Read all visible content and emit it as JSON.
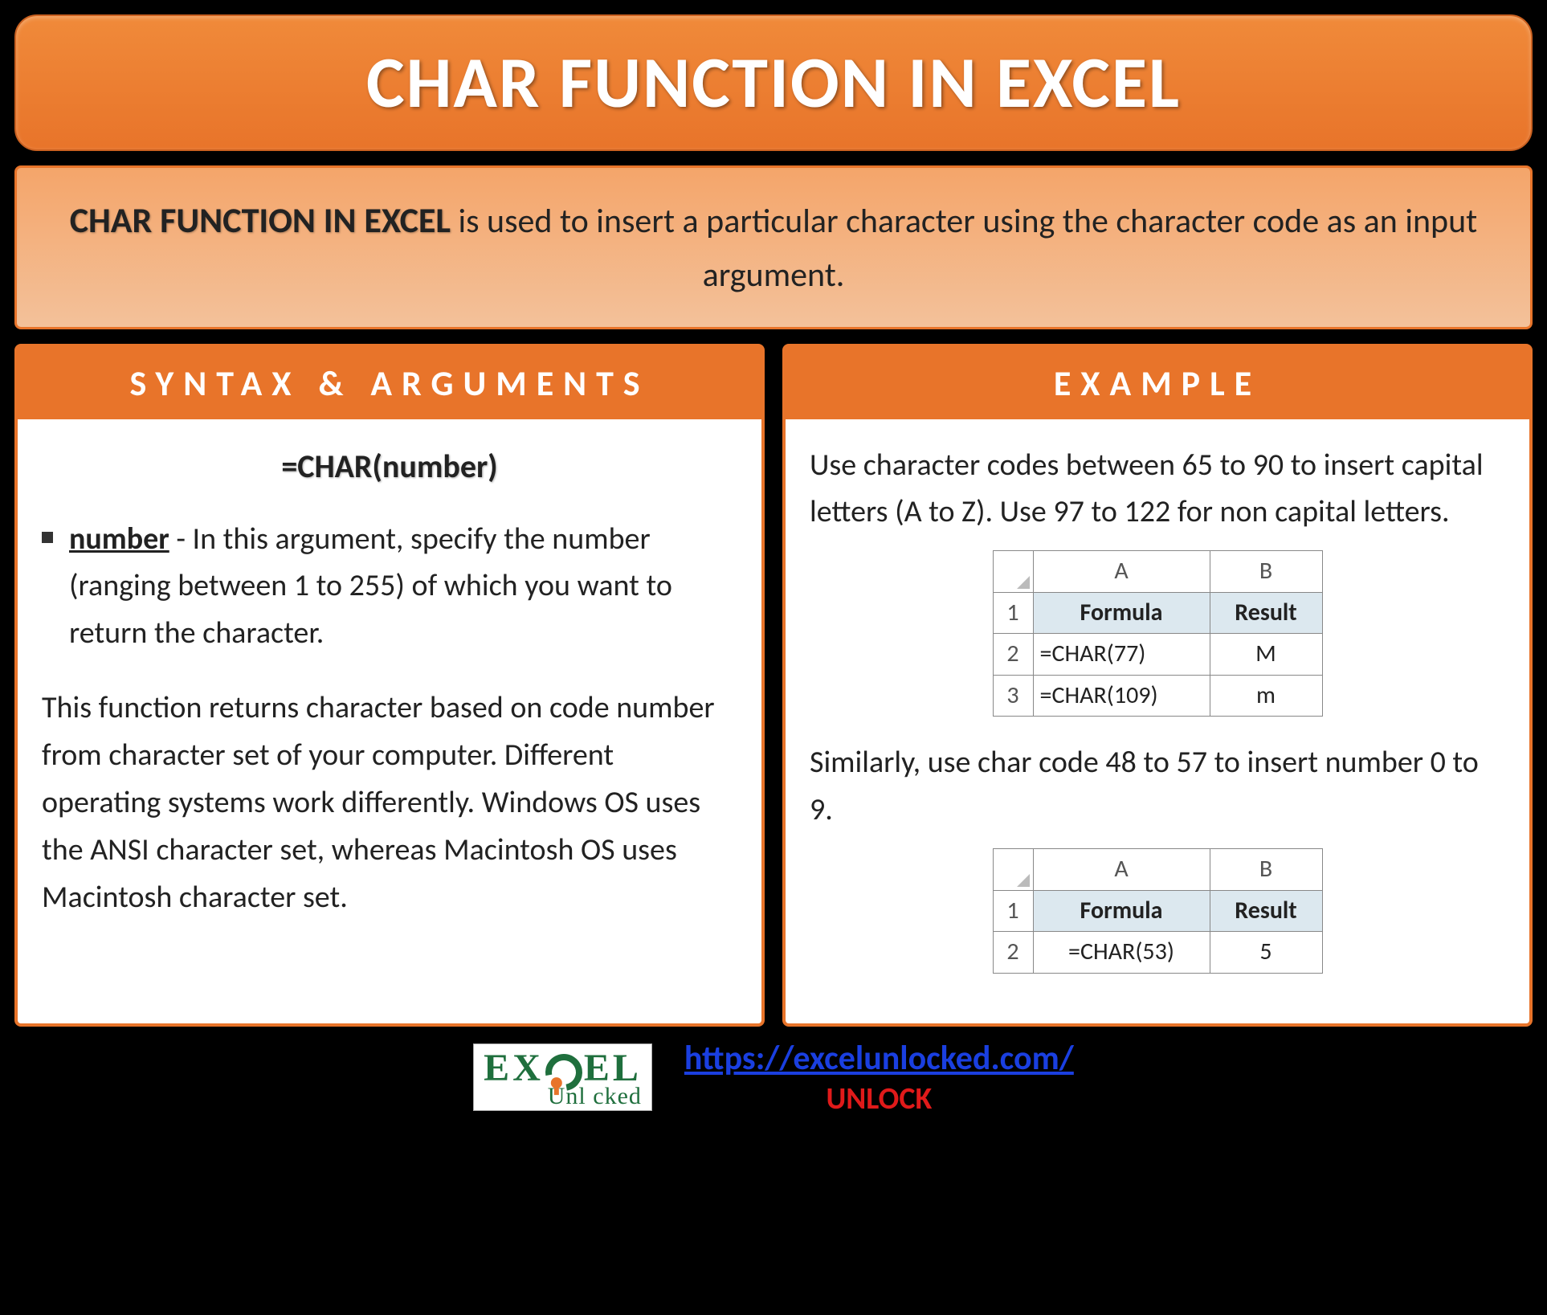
{
  "title": "CHAR FUNCTION IN EXCEL",
  "intro": {
    "bold": "CHAR FUNCTION IN EXCEL",
    "rest": " is used to insert a particular character using the character code as an input argument."
  },
  "syntax": {
    "header": "SYNTAX & ARGUMENTS",
    "formula": "=CHAR(number)",
    "arg_name": "number",
    "arg_desc": " - In this argument, specify the number (ranging between 1 to 255) of which you want to return the character.",
    "paragraph": "This function returns character based on code number from character set of your computer. Different operating systems work differently. Windows OS uses the ANSI character set, whereas Macintosh OS uses Macintosh character set."
  },
  "example": {
    "header": "EXAMPLE",
    "para1": "Use character codes between 65 to 90 to insert capital letters (A to Z). Use 97 to 122 for non capital letters.",
    "table1": {
      "colA": "A",
      "colB": "B",
      "h1": "Formula",
      "h2": "Result",
      "rows": [
        {
          "n": "2",
          "a": "=CHAR(77)",
          "b": "M"
        },
        {
          "n": "3",
          "a": "=CHAR(109)",
          "b": "m"
        }
      ]
    },
    "para2": "Similarly, use char code 48 to 57 to insert number 0 to 9.",
    "table2": {
      "colA": "A",
      "colB": "B",
      "h1": "Formula",
      "h2": "Result",
      "rows": [
        {
          "n": "2",
          "a": "=CHAR(53)",
          "b": "5"
        }
      ]
    }
  },
  "footer": {
    "logo_top_1": "EX",
    "logo_top_2": "EL",
    "logo_bottom": "Unl   cked",
    "url": "https://excelunlocked.com/",
    "unlock": "UNLOCK"
  }
}
